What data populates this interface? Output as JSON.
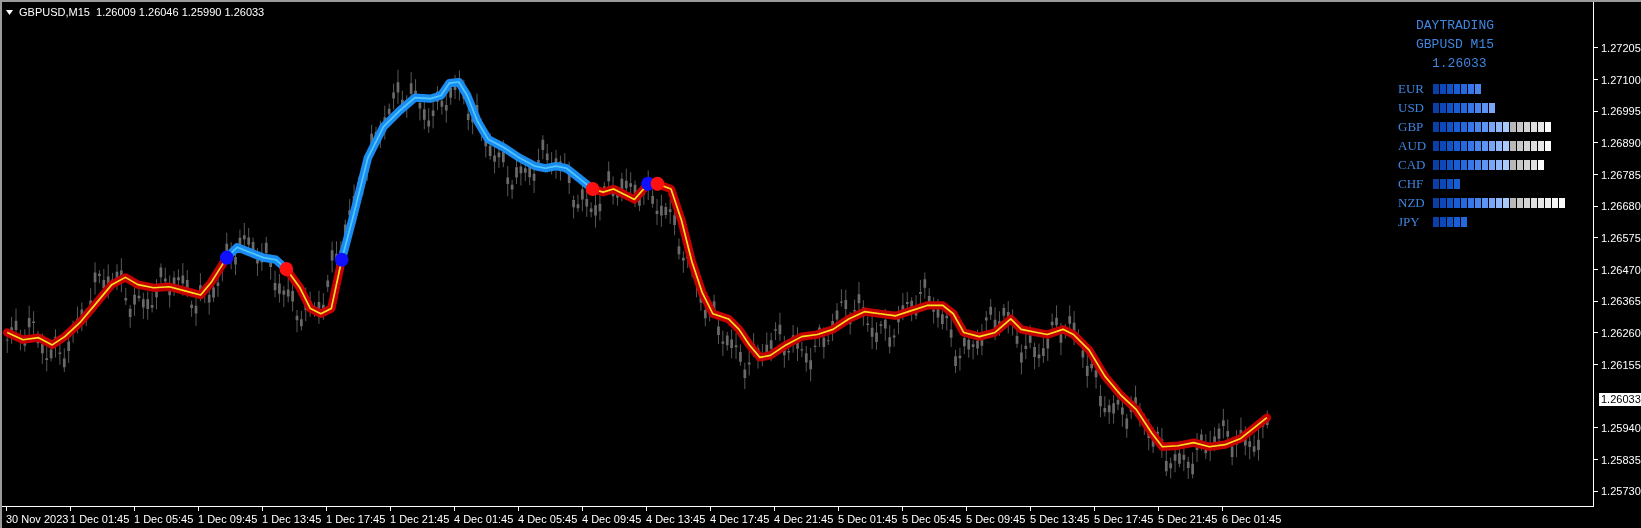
{
  "chart_header": {
    "text": "GBPUSD,M15  1.26009 1.26046 1.25990 1.26033"
  },
  "info_panel": {
    "title": "DAYTRADING",
    "symbol_timeframe": "GBPUSD M15",
    "price": "1.26033",
    "currencies": [
      {
        "name": "EUR",
        "blocks": [
          {
            "color": "#0a3fa8"
          },
          {
            "color": "#0c48b8"
          },
          {
            "color": "#1052c8"
          },
          {
            "color": "#1a5ed6"
          },
          {
            "color": "#2569e0"
          },
          {
            "color": "#3676e8"
          },
          {
            "color": "#4985ee"
          }
        ]
      },
      {
        "name": "USD",
        "blocks": [
          {
            "color": "#0a3fa8"
          },
          {
            "color": "#0c48b8"
          },
          {
            "color": "#1052c8"
          },
          {
            "color": "#1a5ed6"
          },
          {
            "color": "#2569e0"
          },
          {
            "color": "#3676e8"
          },
          {
            "color": "#4985ee"
          },
          {
            "color": "#5e95f2"
          },
          {
            "color": "#76a6f5"
          }
        ]
      },
      {
        "name": "GBP",
        "blocks": [
          {
            "color": "#0a3fa8"
          },
          {
            "color": "#0c48b8"
          },
          {
            "color": "#1052c8"
          },
          {
            "color": "#1a5ed6"
          },
          {
            "color": "#2569e0"
          },
          {
            "color": "#3676e8"
          },
          {
            "color": "#4985ee"
          },
          {
            "color": "#5e95f2"
          },
          {
            "color": "#76a6f5"
          },
          {
            "color": "#90b8f8"
          },
          {
            "color": "#a9c9fa"
          },
          {
            "color": "#b8b8b8"
          },
          {
            "color": "#c8c8c8"
          },
          {
            "color": "#d4d4d4"
          },
          {
            "color": "#dedede"
          },
          {
            "color": "#e6e6e6"
          },
          {
            "color": "#fafafa"
          }
        ]
      },
      {
        "name": "AUD",
        "blocks": [
          {
            "color": "#0a3fa8"
          },
          {
            "color": "#0c48b8"
          },
          {
            "color": "#1052c8"
          },
          {
            "color": "#1a5ed6"
          },
          {
            "color": "#2569e0"
          },
          {
            "color": "#3676e8"
          },
          {
            "color": "#4985ee"
          },
          {
            "color": "#5e95f2"
          },
          {
            "color": "#76a6f5"
          },
          {
            "color": "#90b8f8"
          },
          {
            "color": "#a9c9fa"
          },
          {
            "color": "#b8b8b8"
          },
          {
            "color": "#c8c8c8"
          },
          {
            "color": "#d4d4d4"
          },
          {
            "color": "#dedede"
          },
          {
            "color": "#e6e6e6"
          },
          {
            "color": "#fafafa"
          }
        ]
      },
      {
        "name": "CAD",
        "blocks": [
          {
            "color": "#0a3fa8"
          },
          {
            "color": "#0c48b8"
          },
          {
            "color": "#1052c8"
          },
          {
            "color": "#1a5ed6"
          },
          {
            "color": "#2569e0"
          },
          {
            "color": "#3676e8"
          },
          {
            "color": "#4985ee"
          },
          {
            "color": "#5e95f2"
          },
          {
            "color": "#76a6f5"
          },
          {
            "color": "#90b8f8"
          },
          {
            "color": "#a9c9fa"
          },
          {
            "color": "#b8b8b8"
          },
          {
            "color": "#c8c8c8"
          },
          {
            "color": "#d4d4d4"
          },
          {
            "color": "#dedede"
          },
          {
            "color": "#fafafa"
          }
        ]
      },
      {
        "name": "CHF",
        "blocks": [
          {
            "color": "#0a3fa8"
          },
          {
            "color": "#0c48b8"
          },
          {
            "color": "#1052c8"
          },
          {
            "color": "#1a5ed6"
          }
        ]
      },
      {
        "name": "NZD",
        "blocks": [
          {
            "color": "#0a3fa8"
          },
          {
            "color": "#0c48b8"
          },
          {
            "color": "#1052c8"
          },
          {
            "color": "#1a5ed6"
          },
          {
            "color": "#2569e0"
          },
          {
            "color": "#3676e8"
          },
          {
            "color": "#4985ee"
          },
          {
            "color": "#5e95f2"
          },
          {
            "color": "#76a6f5"
          },
          {
            "color": "#90b8f8"
          },
          {
            "color": "#a9c9fa"
          },
          {
            "color": "#b8b8b8"
          },
          {
            "color": "#c8c8c8"
          },
          {
            "color": "#d4d4d4"
          },
          {
            "color": "#dedede"
          },
          {
            "color": "#e6e6e6"
          },
          {
            "color": "#eeeeee"
          },
          {
            "color": "#f4f4f4"
          },
          {
            "color": "#fafafa"
          }
        ]
      },
      {
        "name": "JPY",
        "blocks": [
          {
            "color": "#0a3fa8"
          },
          {
            "color": "#0c48b8"
          },
          {
            "color": "#1052c8"
          },
          {
            "color": "#1a5ed6"
          },
          {
            "color": "#2569e0"
          }
        ]
      }
    ]
  },
  "price_axis": {
    "upper_ticks": [
      "1.27205",
      "1.27100",
      "1.26995",
      "1.26890",
      "1.26785",
      "1.26680",
      "1.26575",
      "1.26470",
      "1.26365",
      "1.26260",
      "1.26155"
    ],
    "current_price": "1.26033",
    "lower_ticks": [
      "1.25940",
      "1.25835",
      "1.25730"
    ]
  },
  "time_axis": {
    "labels": [
      "30 Nov 2023",
      "1 Dec 01:45",
      "1 Dec 05:45",
      "1 Dec 09:45",
      "1 Dec 13:45",
      "1 Dec 17:45",
      "1 Dec 21:45",
      "4 Dec 01:45",
      "4 Dec 05:45",
      "4 Dec 09:45",
      "4 Dec 13:45",
      "4 Dec 17:45",
      "4 Dec 21:45",
      "5 Dec 01:45",
      "5 Dec 05:45",
      "5 Dec 09:45",
      "5 Dec 13:45",
      "5 Dec 17:45",
      "5 Dec 21:45",
      "6 Dec 01:45"
    ]
  }
}
